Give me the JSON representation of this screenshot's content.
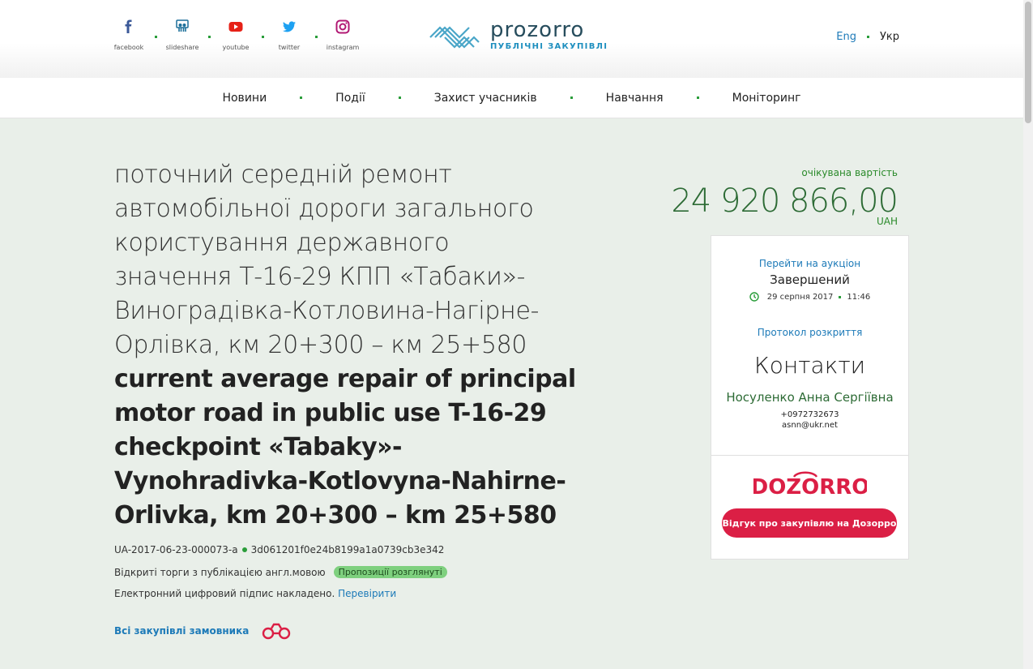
{
  "header": {
    "social": [
      {
        "name": "facebook-icon",
        "label": "facebook",
        "color": "#3b5998"
      },
      {
        "name": "slideshare-icon",
        "label": "slideshare",
        "color": "#1d6f9a"
      },
      {
        "name": "youtube-icon",
        "label": "youtube",
        "color": "#e62117"
      },
      {
        "name": "twitter-icon",
        "label": "twitter",
        "color": "#1da1f2"
      },
      {
        "name": "instagram-icon",
        "label": "instagram",
        "color": "#b11873"
      }
    ],
    "logo_name": "prozorro",
    "logo_sub": "ПУБЛІЧНІ ЗАКУПІВЛІ",
    "lang_eng": "Eng",
    "lang_ukr": "Укр"
  },
  "nav": {
    "items": [
      "Новини",
      "Події",
      "Захист учасників",
      "Навчання",
      "Моніторинг"
    ]
  },
  "tender": {
    "title_ua": "поточний середній ремонт автомобільної дороги загального користування державного значення Т-16-29 КПП «Табаки»-Виноградівка-Котловина-Нагірне-Орлівка, км 20+300 – км 25+580",
    "title_en": "current average repair of principal motor road in public use T-16-29 checkpoint «Tabaky»-Vynohradivka-Kotlovyna-Nahirne-Orlivka, km 20+300 – km 25+580",
    "id": "UA-2017-06-23-000073-a",
    "hash": "3d061201f0e24b8199a1a0739cb3e342",
    "procedure": "Відкриті торги з публікацією англ.мовою",
    "status_badge": "Пропозиції розглянуті",
    "signature_text": "Електронний цифровий підпис накладено.",
    "signature_link": "Перевірити",
    "all_purchases": "Всі закупівлі замовника"
  },
  "sidebar": {
    "expected_label": "очікувана вартість",
    "expected_value": "24 920 866,00",
    "currency": "UAH",
    "auction_link": "Перейти на аукціон",
    "auction_status": "Завершений",
    "auction_date": "29 серпня 2017",
    "auction_time": "11:46",
    "protocol_link": "Протокол розкриття",
    "contacts_heading": "Контакти",
    "contact_name": "Носуленко Анна Сергіївна",
    "contact_phone": "+0972732673",
    "contact_email": "asnn@ukr.net",
    "dozorro_logo": "DOZORRO",
    "dozorro_button": "Відгук про закупівлю на Дозорро"
  },
  "colors": {
    "accent_green": "#2d6b35",
    "link_blue": "#1d7ab8",
    "dozorro_red": "#db1f45",
    "badge_green": "#7ed07e"
  }
}
